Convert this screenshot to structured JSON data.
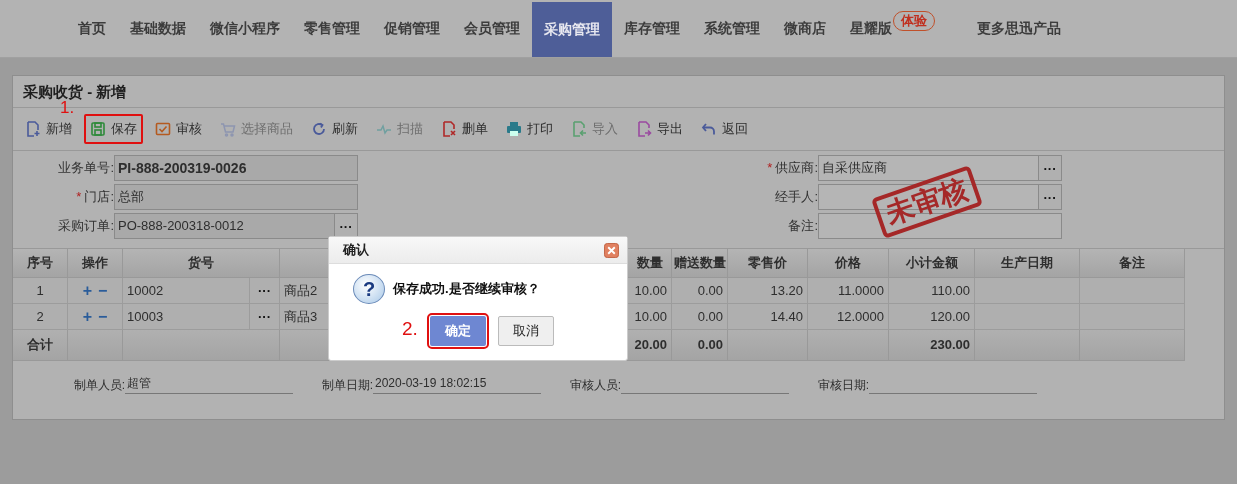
{
  "nav": {
    "items": [
      {
        "label": "首页",
        "selected": false
      },
      {
        "label": "基础数据",
        "selected": false
      },
      {
        "label": "微信小程序",
        "selected": false
      },
      {
        "label": "零售管理",
        "selected": false
      },
      {
        "label": "促销管理",
        "selected": false
      },
      {
        "label": "会员管理",
        "selected": false
      },
      {
        "label": "采购管理",
        "selected": true
      },
      {
        "label": "库存管理",
        "selected": false
      },
      {
        "label": "系统管理",
        "selected": false
      },
      {
        "label": "微商店",
        "selected": false
      },
      {
        "label": "星耀版",
        "selected": false,
        "badge": "体验"
      },
      {
        "label": "更多思迅产品",
        "selected": false
      }
    ]
  },
  "panel": {
    "title": "采购收货 - 新增",
    "toolbar": [
      {
        "label": "新增",
        "disabled": false
      },
      {
        "label": "保存",
        "disabled": false,
        "callout": "1."
      },
      {
        "label": "审核",
        "disabled": false
      },
      {
        "label": "选择商品",
        "disabled": true
      },
      {
        "label": "刷新",
        "disabled": false
      },
      {
        "label": "扫描",
        "disabled": true
      },
      {
        "label": "删单",
        "disabled": false
      },
      {
        "label": "打印",
        "disabled": false
      },
      {
        "label": "导入",
        "disabled": true
      },
      {
        "label": "导出",
        "disabled": false
      },
      {
        "label": "返回",
        "disabled": false
      }
    ],
    "form_left": [
      {
        "label": "业务单号:",
        "value": "PI-888-200319-0026",
        "required": false,
        "lookup": false,
        "bold": true
      },
      {
        "label": "门店:",
        "value": "总部",
        "required": true,
        "lookup": false,
        "bold": false
      },
      {
        "label": "采购订单:",
        "value": "PO-888-200318-0012",
        "required": false,
        "lookup": true,
        "bold": false
      }
    ],
    "form_right": [
      {
        "label": "供应商:",
        "value": "自采供应商",
        "required": true,
        "lookup": true
      },
      {
        "label": "经手人:",
        "required": false,
        "lookup": true
      },
      {
        "label": "备注:",
        "required": false,
        "lookup": false
      }
    ],
    "lookup_glyph": "···",
    "required_glyph": "*",
    "add_glyph": "+",
    "remove_glyph": "−",
    "stamp": "未审核",
    "table": {
      "columns": [
        "序号",
        "操作",
        "货号",
        "",
        "数量",
        "赠送数量",
        "零售价",
        "价格",
        "小计金额",
        "生产日期",
        "备注"
      ],
      "rows": [
        {
          "no": "1",
          "code": "10002",
          "name": "商品2",
          "qty": "10.00",
          "gift": "0.00",
          "retail": "13.20",
          "price": "11.0000",
          "subtotal": "110.00"
        },
        {
          "no": "2",
          "code": "10003",
          "name": "商品3",
          "qty": "10.00",
          "gift": "0.00",
          "retail": "14.40",
          "price": "12.0000",
          "subtotal": "120.00"
        }
      ],
      "total": {
        "label": "合计",
        "qty": "20.00",
        "gift": "0.00",
        "subtotal": "230.00"
      }
    },
    "footer": [
      {
        "label": "制单人员:",
        "value": "超管"
      },
      {
        "label": "制单日期:",
        "value": "2020-03-19 18:02:15"
      },
      {
        "label": "审核人员:"
      },
      {
        "label": "审核日期:"
      }
    ]
  },
  "dialog": {
    "title": "确认",
    "icon_glyph": "?",
    "message": "保存成功.是否继续审核？",
    "buttons": [
      {
        "label": "确定",
        "primary": true,
        "callout": "2."
      },
      {
        "label": "取消",
        "primary": false
      }
    ]
  }
}
